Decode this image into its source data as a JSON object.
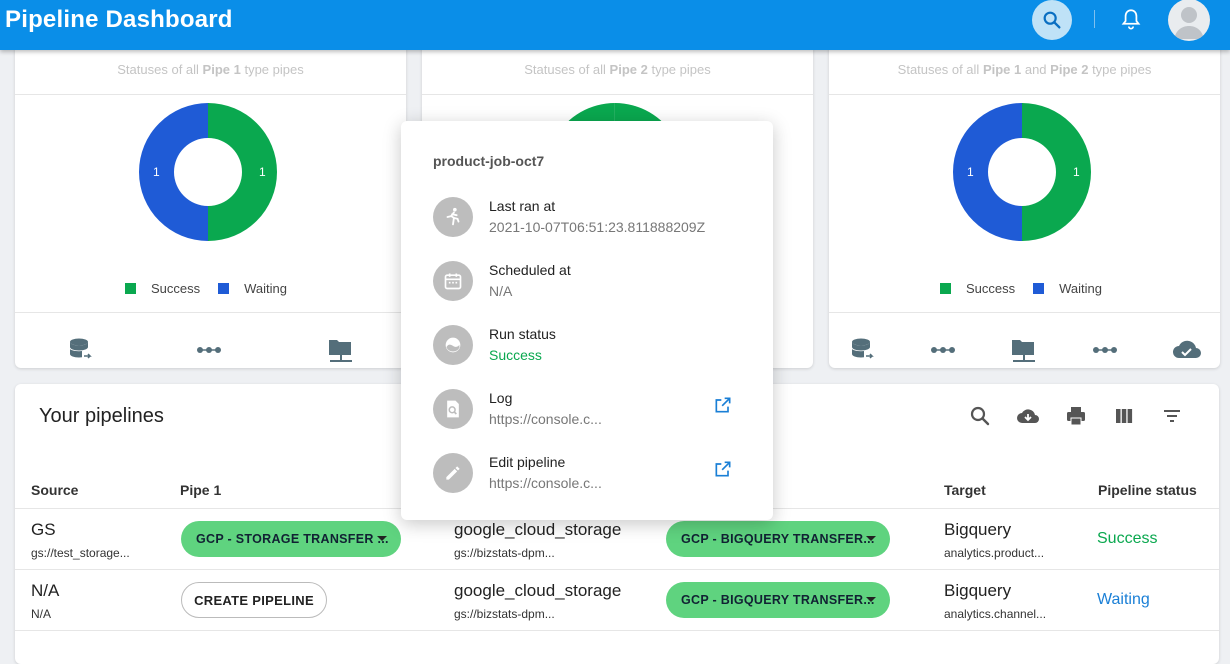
{
  "appbar": {
    "title": "Pipeline Dashboard"
  },
  "cards": [
    {
      "subtitle_pre": "Statuses of all ",
      "subtitle_b1": "Pipe 1",
      "subtitle_mid": " type pipes",
      "subtitle_b2": "",
      "subtitle_post": "",
      "success": 1,
      "waiting": 1
    },
    {
      "subtitle_pre": "Statuses of all ",
      "subtitle_b1": "Pipe 2",
      "subtitle_mid": " type pipes",
      "subtitle_b2": "",
      "subtitle_post": ""
    },
    {
      "subtitle_pre": "Statuses of all ",
      "subtitle_b1": "Pipe 1",
      "subtitle_mid": " and ",
      "subtitle_b2": "Pipe 2",
      "subtitle_post": " type pipes",
      "success": 1,
      "waiting": 1
    }
  ],
  "legend": {
    "success": "Success",
    "waiting": "Waiting"
  },
  "colors": {
    "success": "#0aa84f",
    "waiting": "#1f5bd6",
    "chip": "#5fd37f",
    "link": "#1a7fd6",
    "appbar": "#0a8ee8"
  },
  "popover": {
    "title": "product-job-oct7",
    "items": [
      {
        "key": "Last ran at",
        "value": "2021-10-07T06:51:23.811888209Z",
        "icon": "run-icon"
      },
      {
        "key": "Scheduled at",
        "value": "N/A",
        "icon": "calendar-icon"
      },
      {
        "key": "Run status",
        "value": "Success",
        "icon": "status-icon"
      },
      {
        "key": "Log",
        "value": "https://console.c...",
        "icon": "log-search-icon"
      },
      {
        "key": "Edit pipeline",
        "value": "https://console.c...",
        "icon": "edit-icon"
      }
    ]
  },
  "table": {
    "title": "Your pipelines",
    "headers": [
      "Source",
      "Pipe 1",
      "Target",
      "Pipeline status"
    ],
    "rows": [
      {
        "source": "GS",
        "source_sub": "gs://test_storage...",
        "pipe1": "GCP - STORAGE TRANSFER ...",
        "mid": "google_cloud_storage",
        "mid_sub": "gs://bizstats-dpm...",
        "pipe2": "GCP - BIGQUERY TRANSFER...",
        "target": "Bigquery",
        "target_sub": "analytics.product...",
        "status": "Success"
      },
      {
        "source": "N/A",
        "source_sub": "N/A",
        "pipe1": "CREATE PIPELINE",
        "mid": "google_cloud_storage",
        "mid_sub": "gs://bizstats-dpm...",
        "pipe2": "GCP - BIGQUERY TRANSFER...",
        "target": "Bigquery",
        "target_sub": "analytics.channel...",
        "status": "Waiting"
      }
    ]
  }
}
